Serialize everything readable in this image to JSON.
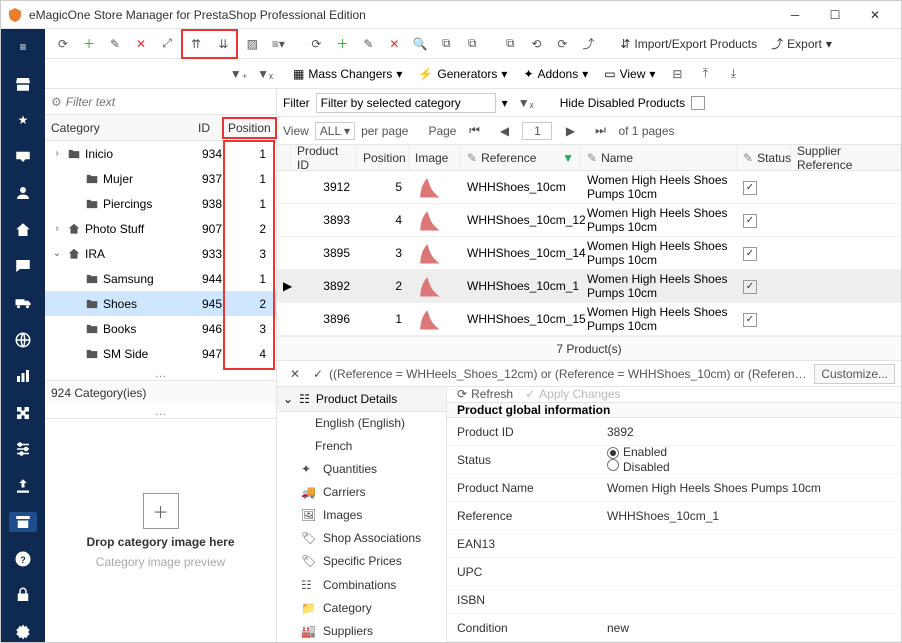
{
  "window": {
    "title": "eMagicOne Store Manager for PrestaShop Professional Edition"
  },
  "toolbar1": {
    "import_export": "Import/Export Products",
    "export": "Export"
  },
  "toolbar2": {
    "mass_changers": "Mass Changers",
    "generators": "Generators",
    "addons": "Addons",
    "view": "View"
  },
  "category_panel": {
    "filter_placeholder": "Filter text",
    "headers": {
      "category": "Category",
      "id": "ID",
      "position": "Position"
    },
    "rows": [
      {
        "indent": 0,
        "chev": ">",
        "icon": "folder",
        "name": "Inicio",
        "id": "934",
        "pos": "1"
      },
      {
        "indent": 1,
        "chev": "",
        "icon": "folder",
        "name": "Mujer",
        "id": "937",
        "pos": "1"
      },
      {
        "indent": 1,
        "chev": "",
        "icon": "folder",
        "name": "Piercings",
        "id": "938",
        "pos": "1"
      },
      {
        "indent": 0,
        "chev": ">",
        "icon": "home",
        "name": "Photo Stuff",
        "id": "907",
        "pos": "2"
      },
      {
        "indent": 0,
        "chev": "v",
        "icon": "home",
        "name": "IRA",
        "id": "933",
        "pos": "3"
      },
      {
        "indent": 1,
        "chev": "",
        "icon": "folder",
        "name": "Samsung",
        "id": "944",
        "pos": "1"
      },
      {
        "indent": 1,
        "chev": "",
        "icon": "folder",
        "name": "Shoes",
        "id": "945",
        "pos": "2",
        "selected": true
      },
      {
        "indent": 1,
        "chev": "",
        "icon": "folder",
        "name": "Books",
        "id": "946",
        "pos": "3"
      },
      {
        "indent": 1,
        "chev": "",
        "icon": "folder",
        "name": "SM Side",
        "id": "947",
        "pos": "4"
      }
    ],
    "status": "924 Category(ies)",
    "drop_title": "Drop category image here",
    "drop_sub": "Category image preview"
  },
  "product_panel": {
    "filter_label": "Filter",
    "filter_value": "Filter by selected category",
    "hide_disabled": "Hide Disabled Products",
    "view_label": "View",
    "view_all": "ALL",
    "per_page": "per page",
    "page_label": "Page",
    "page_num": "1",
    "of_pages": "of 1 pages",
    "headers": {
      "pid": "Product ID",
      "pos": "Position",
      "img": "Image",
      "ref": "Reference",
      "name": "Name",
      "status": "Status",
      "supplier": "Supplier Reference"
    },
    "rows": [
      {
        "pid": "3912",
        "pos": "5",
        "ref": "WHHShoes_10cm",
        "name": "Women High Heels Shoes Pumps 10cm",
        "checked": true
      },
      {
        "pid": "3893",
        "pos": "4",
        "ref": "WHHShoes_10cm_12",
        "name": "Women High Heels Shoes Pumps 10cm",
        "checked": true
      },
      {
        "pid": "3895",
        "pos": "3",
        "ref": "WHHShoes_10cm_14",
        "name": "Women High Heels Shoes Pumps 10cm",
        "checked": true
      },
      {
        "pid": "3892",
        "pos": "2",
        "ref": "WHHShoes_10cm_1",
        "name": "Women High Heels Shoes Pumps 10cm",
        "checked": true,
        "selected": true
      },
      {
        "pid": "3896",
        "pos": "1",
        "ref": "WHHShoes_10cm_15",
        "name": "Women High Heels Shoes Pumps 10cm",
        "checked": true
      }
    ],
    "count": "7 Product(s)",
    "filter_expr": "((Reference = WHHeels_Shoes_12cm) or (Reference = WHHShoes_10cm) or (Reference = WHHShoes_10cm_1) or (Refe",
    "customize": "Customize..."
  },
  "detail": {
    "header": "Product Details",
    "langs": {
      "english": "English (English)",
      "french": "French"
    },
    "nav": [
      "Quantities",
      "Carriers",
      "Images",
      "Shop Associations",
      "Specific Prices",
      "Combinations",
      "Category",
      "Suppliers"
    ],
    "refresh": "Refresh",
    "apply": "Apply Changes",
    "section": "Product global information",
    "fields": {
      "pid_label": "Product ID",
      "pid": "3892",
      "status_label": "Status",
      "enabled": "Enabled",
      "disabled": "Disabled",
      "name_label": "Product Name",
      "name": "Women High Heels Shoes Pumps 10cm",
      "ref_label": "Reference",
      "ref": "WHHShoes_10cm_1",
      "ean_label": "EAN13",
      "upc_label": "UPC",
      "isbn_label": "ISBN",
      "cond_label": "Condition",
      "cond": "new"
    }
  }
}
